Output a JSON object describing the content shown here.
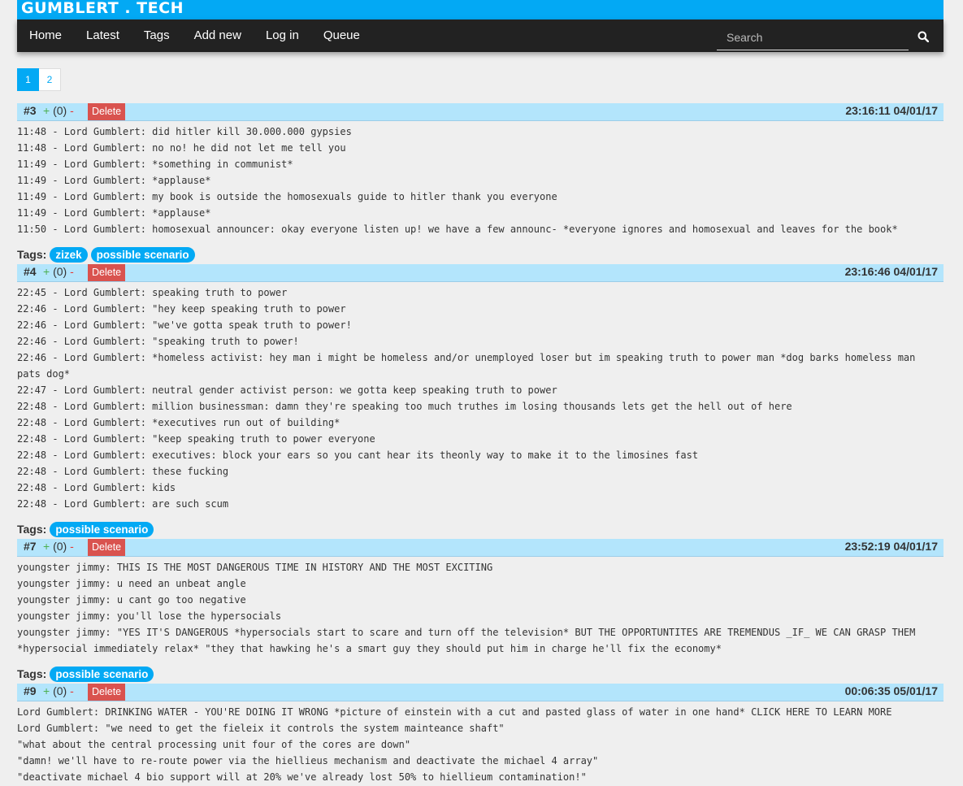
{
  "brand": "GUMBLERT . TECH",
  "nav": [
    "Home",
    "Latest",
    "Tags",
    "Add new",
    "Log in",
    "Queue"
  ],
  "search": {
    "placeholder": "Search",
    "value": ""
  },
  "pagination": {
    "pages": [
      "1",
      "2"
    ],
    "current": "1"
  },
  "labels": {
    "tags": "Tags:",
    "delete": "Delete",
    "plus": "+",
    "minus": "-"
  },
  "quotes": [
    {
      "id": "#3",
      "score": "(0)",
      "date": "23:16:11 04/01/17",
      "lines": [
        "11:48 - Lord Gumblert: did hitler kill 30.000.000 gypsies",
        "11:48 - Lord Gumblert: no no! he did not let me tell you",
        "11:49 - Lord Gumblert: *something in communist*",
        "11:49 - Lord Gumblert: *applause*",
        "11:49 - Lord Gumblert: my book is outside the homosexuals guide to hitler thank you everyone",
        "11:49 - Lord Gumblert: *applause*",
        "11:50 - Lord Gumblert: homosexual announcer: okay everyone listen up! we have a few announc- *everyone ignores and homosexual and leaves for the book*"
      ],
      "tags": [
        "zizek",
        "possible scenario"
      ]
    },
    {
      "id": "#4",
      "score": "(0)",
      "date": "23:16:46 04/01/17",
      "lines": [
        "22:45 - Lord Gumblert: speaking truth to power",
        "22:46 - Lord Gumblert: \"hey keep speaking truth to power",
        "22:46 - Lord Gumblert: \"we've gotta speak truth to power!",
        "22:46 - Lord Gumblert: \"speaking truth to power!",
        "22:46 - Lord Gumblert: *homeless activist: hey man i might be homeless and/or unemployed loser but im speaking truth to power man *dog barks homeless man pats dog*",
        "22:47 - Lord Gumblert: neutral gender activist person: we gotta keep speaking truth to power",
        "22:48 - Lord Gumblert: million businessman: damn they're speaking too much truthes im losing thousands lets get the hell out of here",
        "22:48 - Lord Gumblert: *executives run out of building*",
        "22:48 - Lord Gumblert: \"keep speaking truth to power everyone",
        "22:48 - Lord Gumblert: executives: block your ears so you cant hear its theonly way to make it to the limosines fast",
        "22:48 - Lord Gumblert: these fucking",
        "22:48 - Lord Gumblert: kids",
        "22:48 - Lord Gumblert: are such scum"
      ],
      "tags": [
        "possible scenario"
      ]
    },
    {
      "id": "#7",
      "score": "(0)",
      "date": "23:52:19 04/01/17",
      "lines": [
        "youngster jimmy: THIS IS THE MOST DANGEROUS TIME IN HISTORY AND THE MOST EXCITING",
        "youngster jimmy: u need an unbeat angle",
        "youngster jimmy: u cant go too negative",
        "youngster jimmy: you'll lose the hypersocials",
        "youngster jimmy: \"YES IT'S DANGEROUS *hypersocials start to scare and turn off the television* BUT THE OPPORTUNTITES ARE TREMENDUS _IF_ WE CAN GRASP THEM *hypersocial immediately relax* \"they that hawking he's a smart guy they should put him in charge he'll fix the economy*"
      ],
      "tags": [
        "possible scenario"
      ]
    },
    {
      "id": "#9",
      "score": "(0)",
      "date": "00:06:35 05/01/17",
      "lines": [
        "Lord Gumblert: DRINKING WATER - YOU'RE DOING IT WRONG *picture of einstein with a cut and pasted glass of water in one hand* CLICK HERE TO LEARN MORE",
        "Lord Gumblert: \"we need to get the fieleix it controls the system mainteance shaft\"",
        "\"what about the central processing unit four of the cores are down\"",
        "\"damn! we'll have to re-route power via the hiellieus mechanism and deactivate the michael 4 array\"",
        "\"deactivate michael 4 bio support will at 20% we've already lost 50% to hiellieum contamination!\""
      ],
      "tags": []
    }
  ]
}
